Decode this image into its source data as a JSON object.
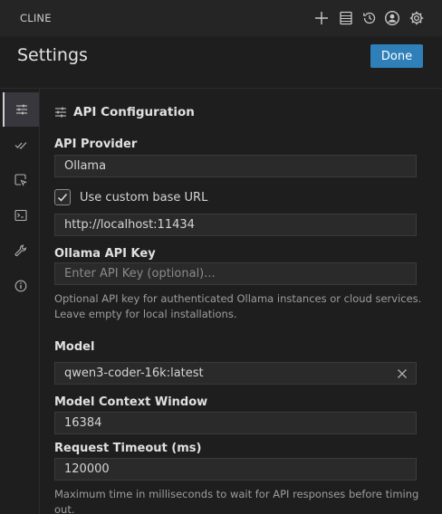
{
  "header": {
    "app_title": "CLINE",
    "icons": [
      "plus-icon",
      "history-list-icon",
      "history-clock-icon",
      "account-icon",
      "gear-icon"
    ]
  },
  "page": {
    "title": "Settings",
    "done_label": "Done"
  },
  "sidebar": {
    "items": [
      {
        "icon": "sliders-icon",
        "active": true
      },
      {
        "icon": "check-all-icon",
        "active": false
      },
      {
        "icon": "cursor-select-icon",
        "active": false
      },
      {
        "icon": "terminal-icon",
        "active": false
      },
      {
        "icon": "wrench-icon",
        "active": false
      },
      {
        "icon": "info-icon",
        "active": false
      }
    ]
  },
  "api_config": {
    "section_title": "API Configuration",
    "provider_label": "API Provider",
    "provider_value": "Ollama",
    "custom_url_checked": true,
    "custom_url_label": "Use custom base URL",
    "base_url_value": "http://localhost:11434",
    "api_key_label": "Ollama API Key",
    "api_key_placeholder": "Enter API Key (optional)...",
    "api_key_value": "",
    "api_key_help_line1": "Optional API key for authenticated Ollama instances or cloud services.",
    "api_key_help_line2": "Leave empty for local installations.",
    "model_label": "Model",
    "model_value": "qwen3-coder-16k:latest",
    "context_label": "Model Context Window",
    "context_value": "16384",
    "timeout_label": "Request Timeout (ms)",
    "timeout_value": "120000",
    "timeout_help": "Maximum time in milliseconds to wait for API responses before timing out."
  },
  "colors": {
    "background": "#1e1e1e",
    "accent_button": "#2f7fb8",
    "field_background": "#2a2a2a"
  }
}
